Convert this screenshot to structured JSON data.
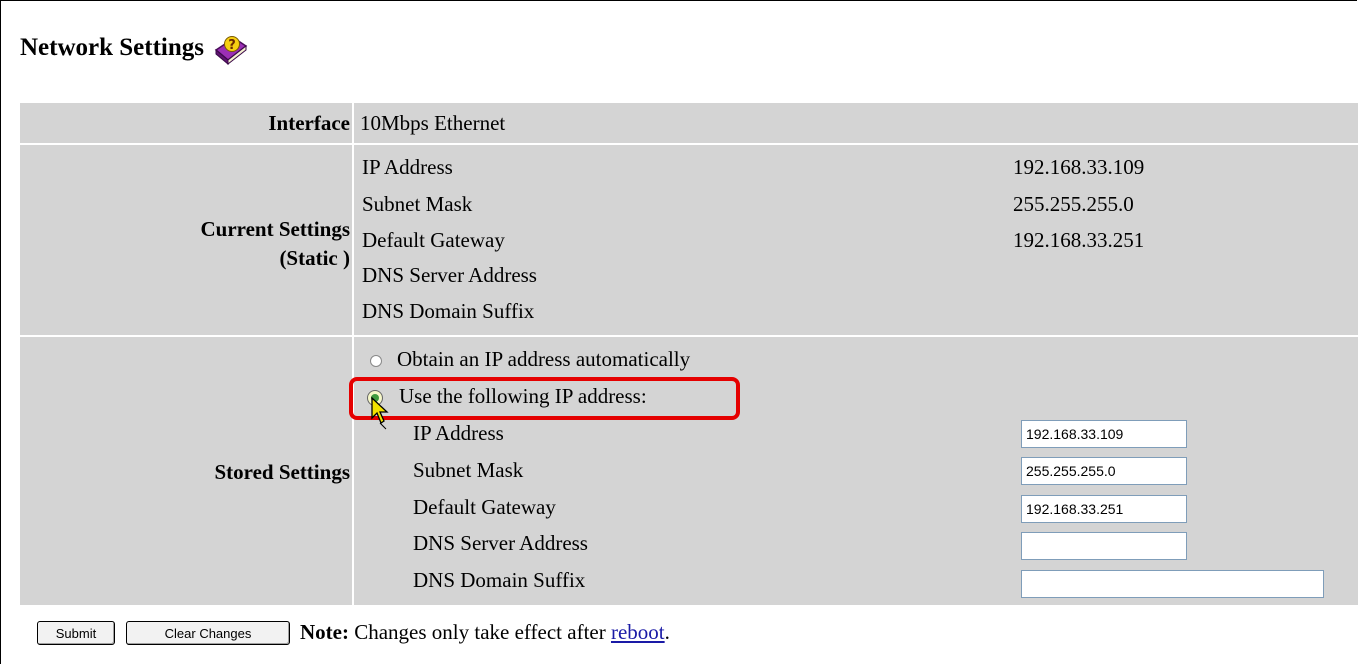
{
  "title": "Network Settings",
  "icons": {
    "help": "help-book-icon",
    "cursor": "mouse-pointer-icon"
  },
  "colors": {
    "panel": "#d4d4d4",
    "highlight": "#e50000",
    "link": "#1a1aa6"
  },
  "interface": {
    "label": "Interface",
    "value": "10Mbps Ethernet"
  },
  "current": {
    "label_line1": "Current Settings",
    "label_line2": "(Static )",
    "rows": [
      {
        "name": "IP Address",
        "value": "192.168.33.109"
      },
      {
        "name": "Subnet Mask",
        "value": "255.255.255.0"
      },
      {
        "name": "Default Gateway",
        "value": "192.168.33.251"
      },
      {
        "name": "DNS Server Address",
        "value": ""
      },
      {
        "name": "DNS Domain Suffix",
        "value": ""
      }
    ]
  },
  "stored": {
    "label": "Stored Settings",
    "radio_auto": "Obtain an IP address automatically",
    "radio_static": "Use the following IP address:",
    "selected": "static",
    "fields": [
      {
        "name": "IP Address",
        "value": "192.168.33.109"
      },
      {
        "name": "Subnet Mask",
        "value": "255.255.255.0"
      },
      {
        "name": "Default Gateway",
        "value": "192.168.33.251"
      },
      {
        "name": "DNS Server Address",
        "value": ""
      },
      {
        "name": "DNS Domain Suffix",
        "value": ""
      }
    ]
  },
  "buttons": {
    "submit": "Submit",
    "clear": "Clear Changes"
  },
  "note": {
    "prefix": "Note:",
    "text": " Changes only take effect after ",
    "link": "reboot",
    "suffix": "."
  }
}
